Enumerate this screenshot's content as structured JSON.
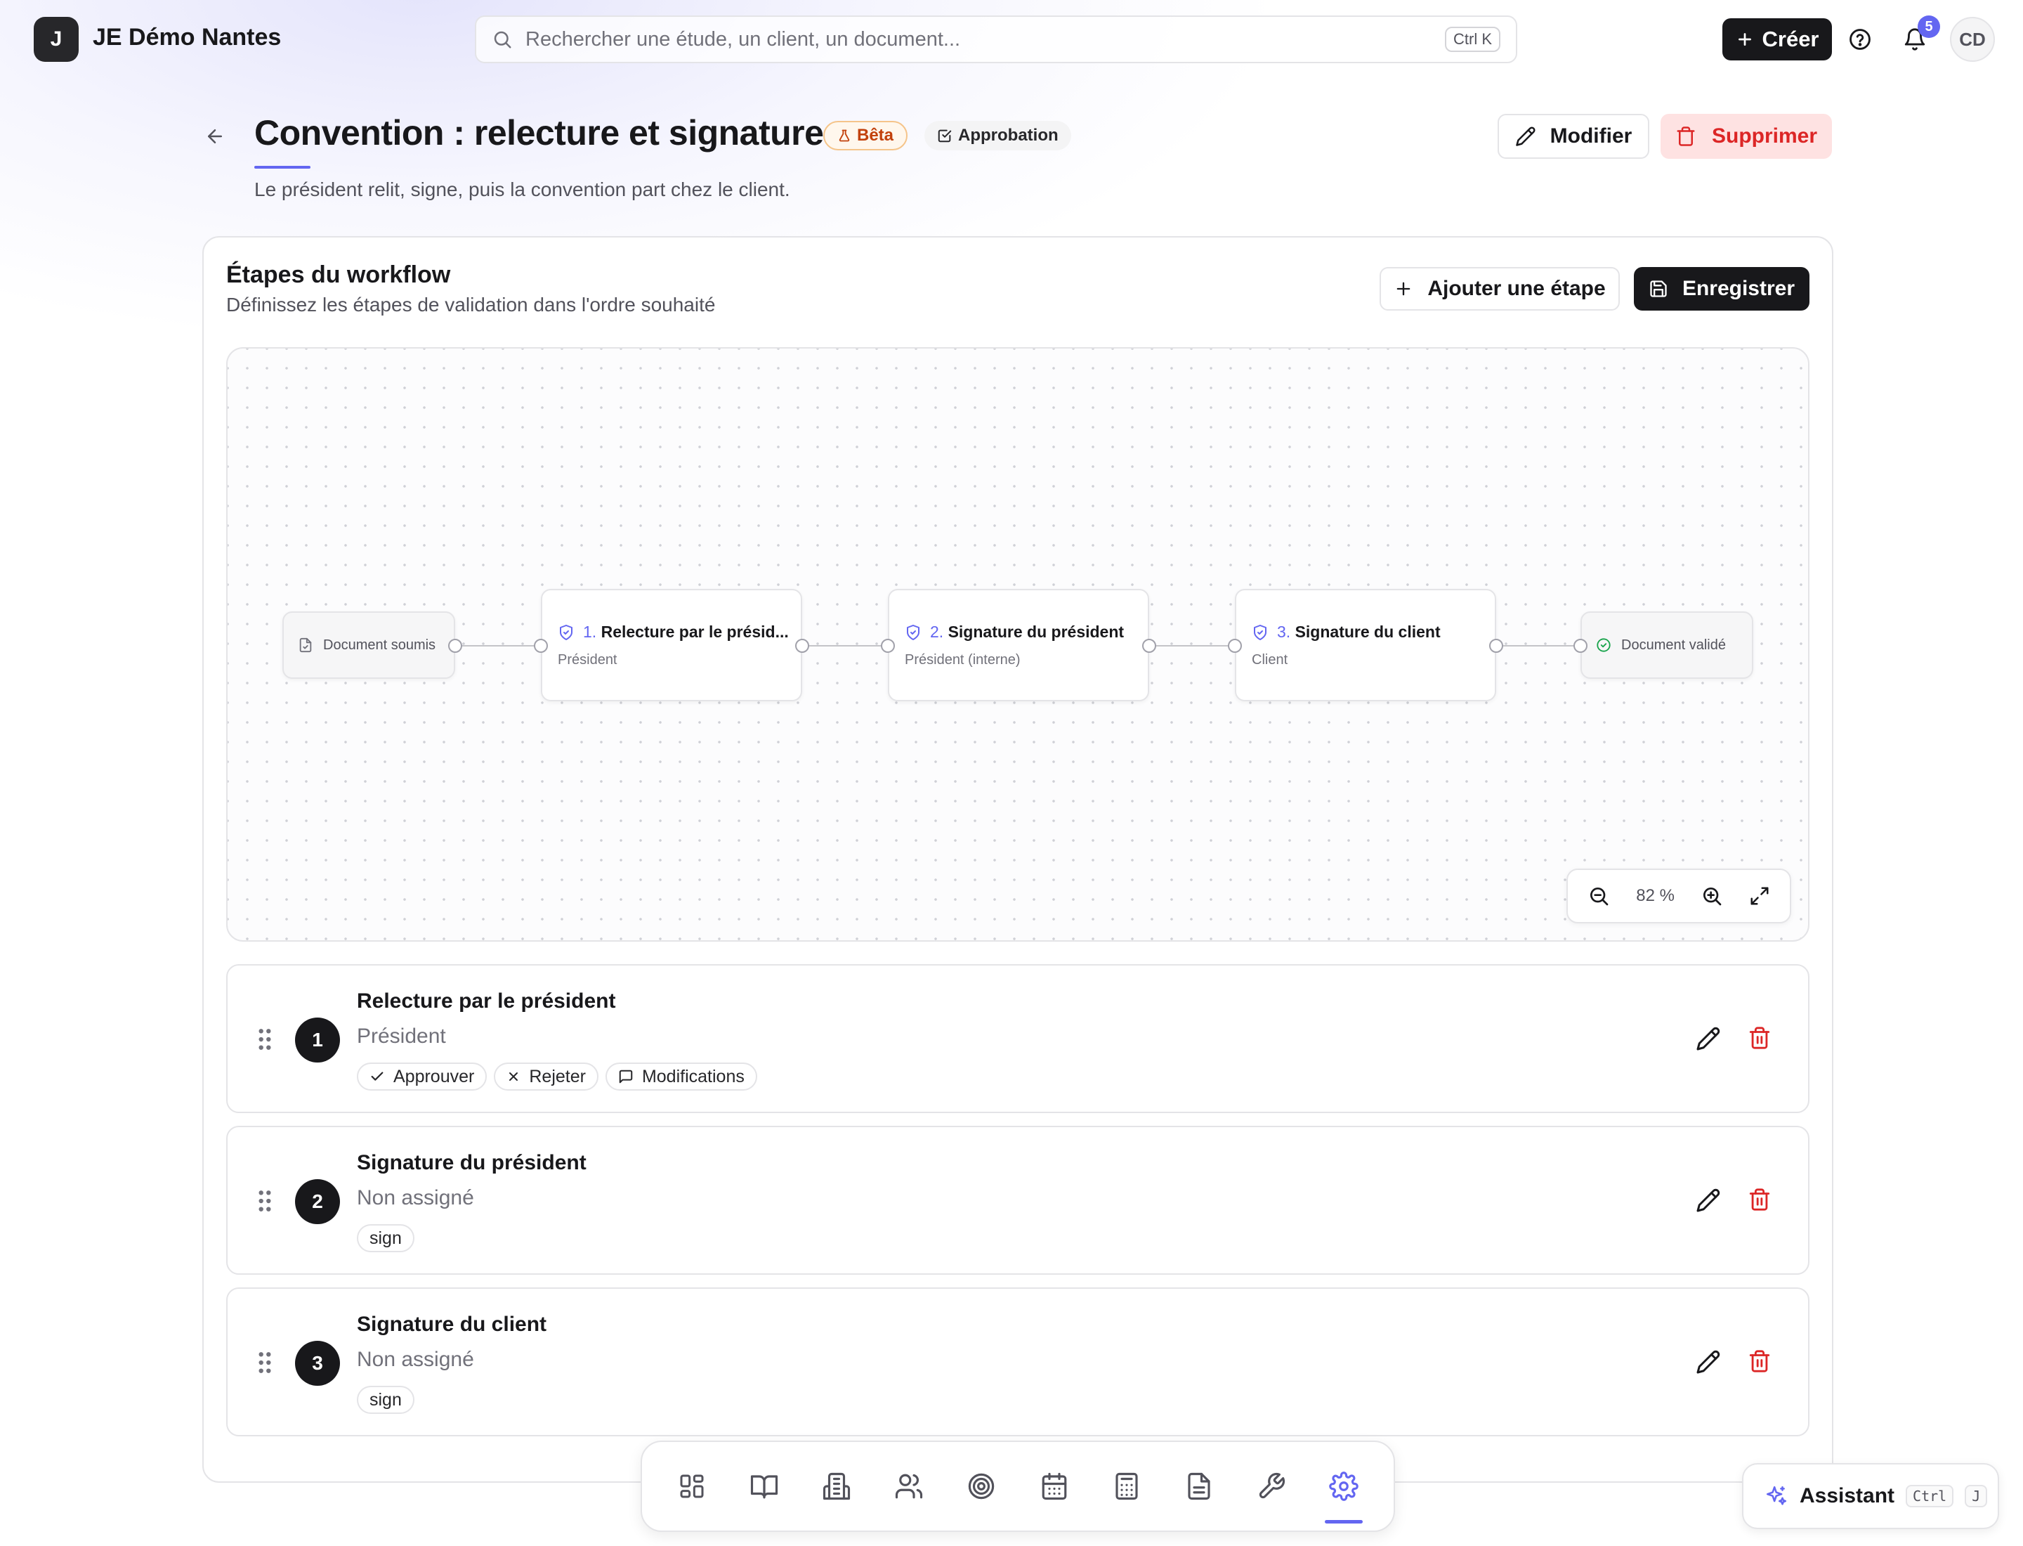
{
  "header": {
    "org_initial": "J",
    "org_name": "JE Démo Nantes",
    "search_placeholder": "Rechercher une étude, un client, un document...",
    "search_shortcut": "Ctrl K",
    "create_label": "Créer",
    "notifications_count": "5",
    "user_initials": "CD"
  },
  "page": {
    "title": "Convention : relecture et signatures",
    "badge_beta": "Bêta",
    "badge_type": "Approbation",
    "subtitle": "Le président relit, signe, puis la convention part chez le client.",
    "edit_label": "Modifier",
    "delete_label": "Supprimer"
  },
  "workflow": {
    "title": "Étapes du workflow",
    "subtitle": "Définissez les étapes de validation dans l'ordre souhaité",
    "add_step_label": "Ajouter une étape",
    "save_label": "Enregistrer",
    "canvas": {
      "start_node": "Document soumis",
      "end_node": "Document validé",
      "nodes": [
        {
          "num": "1.",
          "title": "Relecture par le présid...",
          "role": "Président"
        },
        {
          "num": "2.",
          "title": "Signature du président",
          "role": "Président (interne)"
        },
        {
          "num": "3.",
          "title": "Signature du client",
          "role": "Client"
        }
      ],
      "zoom": "82 %"
    },
    "steps": [
      {
        "num": "1",
        "name": "Relecture par le président",
        "assignee": "Président",
        "chips": [
          {
            "icon": "check-icon",
            "label": "Approuver"
          },
          {
            "icon": "x-icon",
            "label": "Rejeter"
          },
          {
            "icon": "comment-icon",
            "label": "Modifications"
          }
        ]
      },
      {
        "num": "2",
        "name": "Signature du président",
        "assignee": "Non assigné",
        "chips": [
          {
            "label": "sign"
          }
        ]
      },
      {
        "num": "3",
        "name": "Signature du client",
        "assignee": "Non assigné",
        "chips": [
          {
            "label": "sign"
          }
        ]
      }
    ]
  },
  "dock": {
    "items": [
      "dashboard-icon",
      "book-icon",
      "building-icon",
      "users-icon",
      "target-icon",
      "calendar-icon",
      "calculator-icon",
      "document-icon",
      "wrench-icon",
      "gear-icon"
    ],
    "active": "gear-icon"
  },
  "assistant": {
    "label": "Assistant",
    "key1": "Ctrl",
    "key2": "J"
  },
  "colors": {
    "accent": "#6366f1",
    "danger": "#dc2626",
    "primary_dark": "#18181b",
    "beta": "#c2410c",
    "success": "#16a34a"
  }
}
